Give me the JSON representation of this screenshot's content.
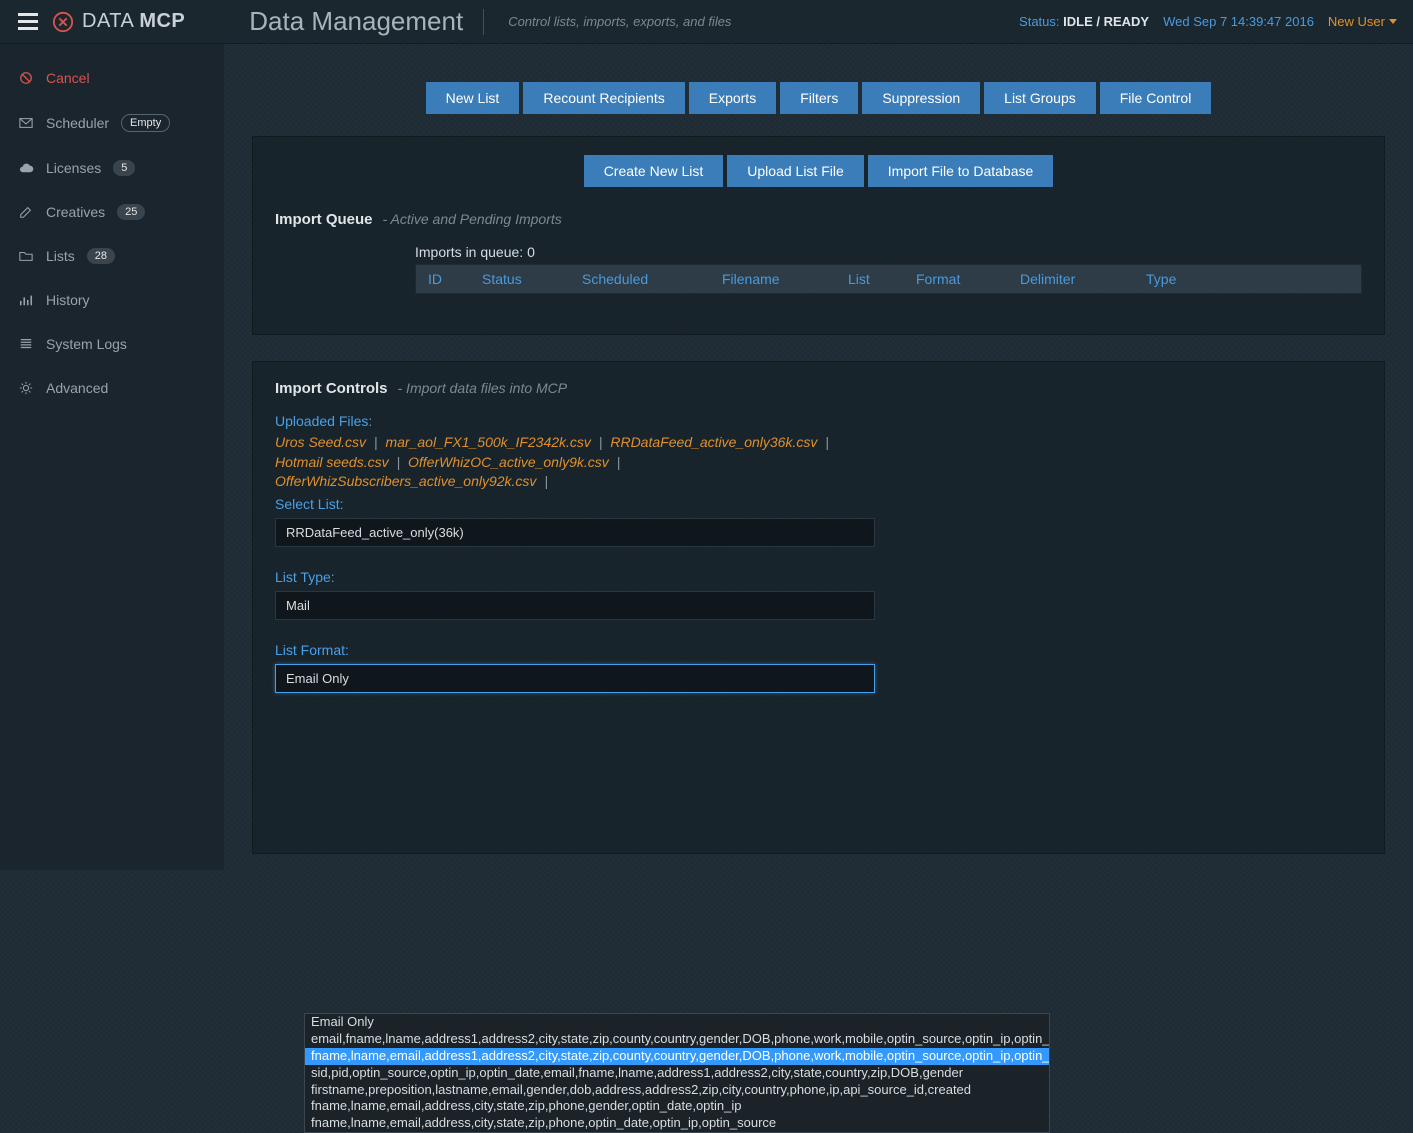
{
  "logo": {
    "prefix": "DATA ",
    "suffix": "MCP"
  },
  "pageTitle": "Data Management",
  "pageSubtitle": "Control lists, imports, exports, and files",
  "status": {
    "label": "Status: ",
    "value": "IDLE / READY"
  },
  "timestamp": "Wed Sep 7 14:39:47 2016",
  "userMenu": "New User",
  "sidebar": {
    "cancel": "Cancel",
    "scheduler": {
      "label": "Scheduler",
      "badge": "Empty"
    },
    "licenses": {
      "label": "Licenses",
      "badge": "5"
    },
    "creatives": {
      "label": "Creatives",
      "badge": "25"
    },
    "lists": {
      "label": "Lists",
      "badge": "28"
    },
    "history": "History",
    "systemLogs": "System Logs",
    "advanced": "Advanced"
  },
  "topButtons": [
    "New List",
    "Recount Recipients",
    "Exports",
    "Filters",
    "Suppression",
    "List Groups",
    "File Control"
  ],
  "subButtons": [
    "Create New List",
    "Upload List File",
    "Import File to Database"
  ],
  "importQueue": {
    "title": "Import Queue",
    "subtitle": "- Active and Pending Imports",
    "countLabel": "Imports in queue: ",
    "count": "0",
    "headers": [
      "ID",
      "Status",
      "Scheduled",
      "Filename",
      "List",
      "Format",
      "Delimiter",
      "Type"
    ]
  },
  "importControls": {
    "title": "Import Controls",
    "subtitle": "- Import data files into MCP",
    "uploadedLabel": "Uploaded Files:",
    "files": [
      "Uros Seed.csv",
      "mar_aol_FX1_500k_IF2342k.csv",
      "RRDataFeed_active_only36k.csv",
      "Hotmail seeds.csv",
      "OfferWhizOC_active_only9k.csv",
      "OfferWhizSubscribers_active_only92k.csv"
    ],
    "selectList": {
      "label": "Select List:",
      "value": "RRDataFeed_active_only(36k)"
    },
    "listType": {
      "label": "List Type:",
      "value": "Mail"
    },
    "listFormat": {
      "label": "List Format:",
      "value": "Email Only",
      "options": [
        "Email Only",
        "email,fname,lname,address1,address2,city,state,zip,county,country,gender,DOB,phone,work,mobile,optin_source,optin_ip,optin_date",
        "fname,lname,email,address1,address2,city,state,zip,county,country,gender,DOB,phone,work,mobile,optin_source,optin_ip,optin_date",
        "sid,pid,optin_source,optin_ip,optin_date,email,fname,lname,address1,address2,city,state,country,zip,DOB,gender",
        "firstname,preposition,lastname,email,gender,dob,address,address2,zip,city,country,phone,ip,api_source_id,created",
        "fname,lname,email,address,city,state,zip,phone,gender,optin_date,optin_ip",
        "fname,lname,email,address,city,state,zip,phone,optin_date,optin_ip,optin_source"
      ],
      "highlightedIndex": 2
    }
  }
}
